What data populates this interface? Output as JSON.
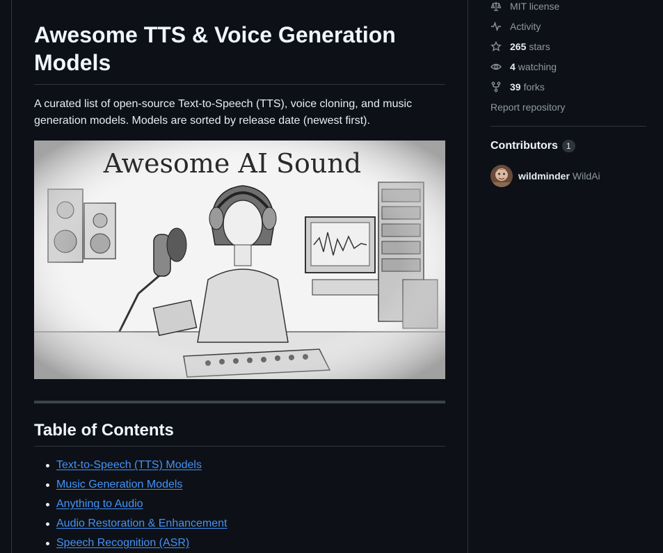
{
  "readme": {
    "title": "Awesome TTS & Voice Generation Models",
    "intro": "A curated list of open-source Text-to-Speech (TTS), voice cloning, and music generation models. Models are sorted by release date (newest first).",
    "banner_text": "Awesome AI Sound",
    "toc_heading": "Table of Contents",
    "toc": [
      "Text-to-Speech (TTS) Models",
      "Music Generation Models",
      "Anything to Audio",
      "Audio Restoration & Enhancement",
      "Speech Recognition (ASR)"
    ]
  },
  "sidebar": {
    "license": {
      "label": "MIT license",
      "icon": "law-icon"
    },
    "activity": {
      "label": "Activity",
      "icon": "pulse-icon"
    },
    "stars": {
      "count": "265",
      "label": "stars",
      "icon": "star-icon"
    },
    "watching": {
      "count": "4",
      "label": "watching",
      "icon": "eye-icon"
    },
    "forks": {
      "count": "39",
      "label": "forks",
      "icon": "fork-icon"
    },
    "report": "Report repository",
    "contributors": {
      "title": "Contributors",
      "count": "1",
      "items": [
        {
          "login": "wildminder",
          "name": "WildAi"
        }
      ]
    }
  },
  "colors": {
    "background": "#0d1117",
    "border": "#30363d",
    "text": "#e6edf3",
    "muted": "#9198a1",
    "link": "#4493f8"
  }
}
